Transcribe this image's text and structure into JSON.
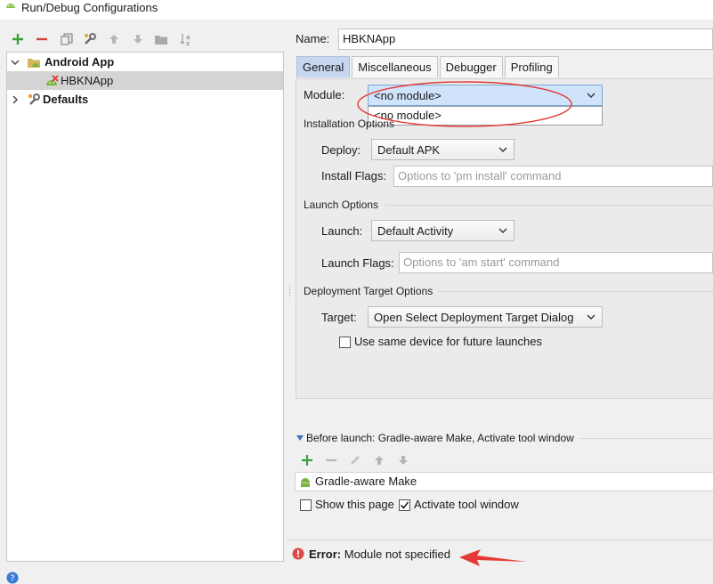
{
  "window": {
    "title": "Run/Debug Configurations"
  },
  "toolbar": {
    "buttons": [
      "add-icon",
      "remove-icon",
      "copy-icon",
      "wrench-icon",
      "move-up-icon",
      "move-down-icon",
      "folder-icon",
      "sort-icon"
    ]
  },
  "tree": {
    "items": [
      {
        "label": "Android App",
        "expanded": true
      },
      {
        "label": "HBKNApp",
        "selected": true
      },
      {
        "label": "Defaults",
        "expanded": false
      }
    ]
  },
  "name_field": {
    "label": "Name:",
    "value": "HBKNApp"
  },
  "tabs": [
    {
      "label": "General",
      "active": true
    },
    {
      "label": "Miscellaneous"
    },
    {
      "label": "Debugger"
    },
    {
      "label": "Profiling"
    }
  ],
  "module": {
    "label": "Module:",
    "value": "<no module>",
    "options": [
      "<no module>"
    ]
  },
  "installation": {
    "section": "Installation Options",
    "deploy_label": "Deploy:",
    "deploy_value": "Default APK",
    "flags_label": "Install Flags:",
    "flags_placeholder": "Options to 'pm install' command"
  },
  "launch": {
    "section": "Launch Options",
    "launch_label": "Launch:",
    "launch_value": "Default Activity",
    "flags_label": "Launch Flags:",
    "flags_placeholder": "Options to 'am start' command"
  },
  "deployment_target": {
    "section": "Deployment Target Options",
    "target_label": "Target:",
    "target_value": "Open Select Deployment Target Dialog",
    "same_device_label": "Use same device for future launches",
    "same_device_checked": false
  },
  "before_launch": {
    "title": "Before launch: Gradle-aware Make, Activate tool window",
    "tasks": [
      "Gradle-aware Make"
    ],
    "show_page_label": "Show this page",
    "show_page_checked": false,
    "activate_label": "Activate tool window",
    "activate_checked": true
  },
  "error": {
    "prefix": "Error:",
    "message": "Module not specified"
  },
  "colors": {
    "accent_green": "#3aa13a",
    "remove_red": "#d0443a",
    "error_red": "#e14949",
    "annotation_red": "#e53935",
    "tab_active": "#c7d7ef"
  }
}
